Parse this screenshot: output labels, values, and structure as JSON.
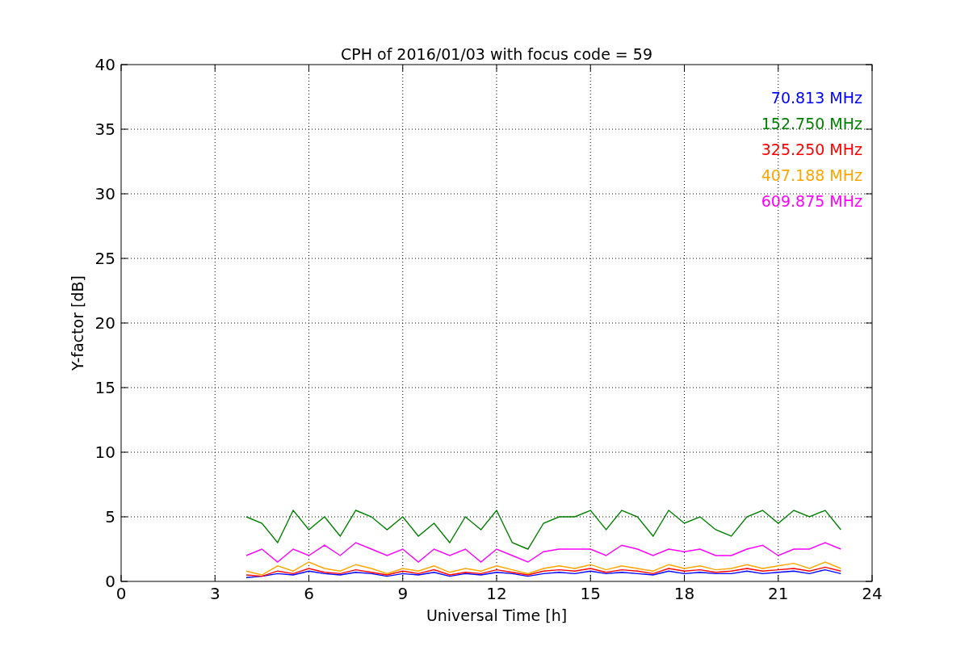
{
  "figure": {
    "chart_data": {
      "type": "line",
      "title": "CPH of 2016/01/03 with focus code = 59",
      "xlabel": "Universal Time [h]",
      "ylabel": "Y-factor [dB]",
      "x": [
        4,
        4.5,
        5,
        5.5,
        6,
        6.5,
        7,
        7.5,
        8,
        8.5,
        9,
        9.5,
        10,
        10.5,
        11,
        11.5,
        12,
        12.5,
        13,
        13.5,
        14,
        14.5,
        15,
        15.5,
        16,
        16.5,
        17,
        17.5,
        18,
        18.5,
        19,
        19.5,
        20,
        20.5,
        21,
        21.5,
        22,
        22.5,
        23
      ],
      "series": [
        {
          "name": "70.813 MHz",
          "color": "#0000ff",
          "values": [
            0.3,
            0.4,
            0.6,
            0.5,
            0.8,
            0.6,
            0.5,
            0.7,
            0.6,
            0.4,
            0.6,
            0.5,
            0.7,
            0.4,
            0.6,
            0.5,
            0.7,
            0.6,
            0.4,
            0.6,
            0.7,
            0.6,
            0.8,
            0.6,
            0.7,
            0.6,
            0.5,
            0.8,
            0.6,
            0.7,
            0.6,
            0.6,
            0.8,
            0.6,
            0.7,
            0.8,
            0.6,
            0.9,
            0.6
          ]
        },
        {
          "name": "152.750 MHz",
          "color": "#008000",
          "values": [
            5,
            4.5,
            3,
            5.5,
            4,
            5,
            3.5,
            5.5,
            5,
            4,
            5,
            3.5,
            4.5,
            3,
            5,
            4,
            5.5,
            3,
            2.5,
            4.5,
            5,
            5,
            5.5,
            4,
            5.5,
            5,
            3.5,
            5.5,
            4.5,
            5,
            4,
            3.5,
            5,
            5.5,
            4.5,
            5.5,
            5,
            5.5,
            4
          ]
        },
        {
          "name": "325.250 MHz",
          "color": "#ff0000",
          "values": [
            0.5,
            0.4,
            0.8,
            0.6,
            1,
            0.7,
            0.6,
            0.9,
            0.7,
            0.5,
            0.8,
            0.6,
            0.9,
            0.5,
            0.7,
            0.6,
            0.9,
            0.7,
            0.5,
            0.8,
            0.9,
            0.8,
            1,
            0.7,
            0.9,
            0.8,
            0.6,
            1,
            0.8,
            0.9,
            0.7,
            0.8,
            1,
            0.8,
            0.9,
            1,
            0.8,
            1.1,
            0.8
          ]
        },
        {
          "name": "407.188 MHz",
          "color": "#ffa500",
          "values": [
            0.8,
            0.5,
            1.2,
            0.8,
            1.5,
            1,
            0.8,
            1.3,
            1,
            0.6,
            1,
            0.8,
            1.2,
            0.7,
            1,
            0.8,
            1.2,
            0.9,
            0.6,
            1,
            1.2,
            1,
            1.3,
            0.9,
            1.2,
            1,
            0.8,
            1.3,
            1,
            1.2,
            0.9,
            1,
            1.3,
            1,
            1.2,
            1.4,
            1,
            1.5,
            1
          ]
        },
        {
          "name": "609.875 MHz",
          "color": "#ff00ff",
          "values": [
            2,
            2.5,
            1.5,
            2.5,
            2,
            2.8,
            2,
            3,
            2.5,
            2,
            2.5,
            1.5,
            2.5,
            2,
            2.5,
            1.5,
            2.5,
            2,
            1.5,
            2.3,
            2.5,
            2.5,
            2.5,
            2,
            2.8,
            2.5,
            2,
            2.5,
            2.3,
            2.5,
            2,
            2,
            2.5,
            2.8,
            2,
            2.5,
            2.5,
            3,
            2.5
          ]
        }
      ],
      "grid": true,
      "xlim": [
        0,
        24
      ],
      "ylim": [
        0,
        40
      ],
      "xticks": [
        0,
        3,
        6,
        9,
        12,
        15,
        18,
        21,
        24
      ],
      "yticks": [
        0,
        5,
        10,
        15,
        20,
        25,
        30,
        35,
        40
      ]
    }
  }
}
